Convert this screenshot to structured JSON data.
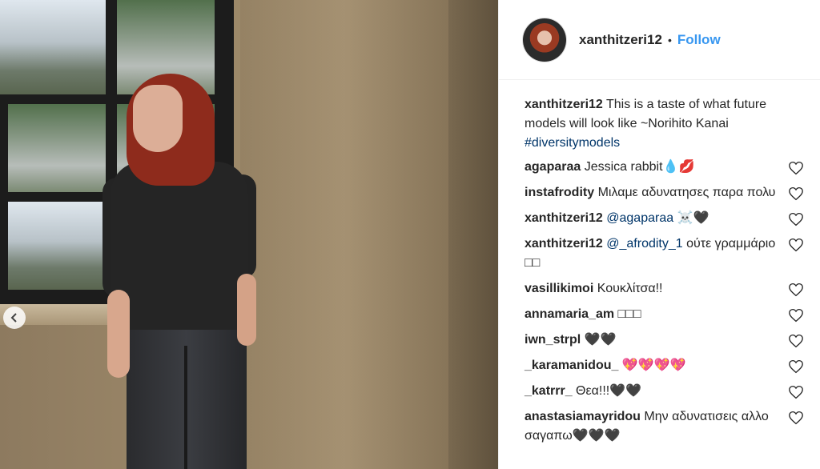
{
  "post_header": {
    "username": "xanthitzeri12",
    "separator": "•",
    "follow_label": "Follow"
  },
  "caption": {
    "user": "xanthitzeri12",
    "text": " This is a taste of what future models will look like ~Norihito Kanai ",
    "hashtag": "#diversitymodels"
  },
  "comments": [
    {
      "user": "agaparaa",
      "text": " Jessica rabbit💧💋"
    },
    {
      "user": "instafrodity",
      "text": " Μιλαμε αδυνατησες παρα πολυ"
    },
    {
      "user": "xanthitzeri12",
      "mention": " @agaparaa",
      "text": " ☠️🖤"
    },
    {
      "user": "xanthitzeri12",
      "mention": " @_afrodity_1",
      "text": " ούτε γραμμάριο □□"
    },
    {
      "user": "vasillikimoi",
      "text": " Κουκλίτσα!!"
    },
    {
      "user": "annamaria_am",
      "text": " □□□"
    },
    {
      "user": "iwn_strpl",
      "text": " 🖤🖤"
    },
    {
      "user": "_karamanidou_",
      "text": " 💖💖💖💖"
    },
    {
      "user": "_katrrr_",
      "text": " Θεα!!!🖤🖤"
    },
    {
      "user": "anastasiamayridou",
      "text": " Μην αδυνατισεις αλλο σαγαπω🖤🖤🖤"
    }
  ],
  "icons": {
    "like": "heart-outline-icon",
    "prev": "chevron-left-icon"
  },
  "colors": {
    "link": "#003569",
    "follow": "#3897f0",
    "heart_stroke": "#262626"
  }
}
